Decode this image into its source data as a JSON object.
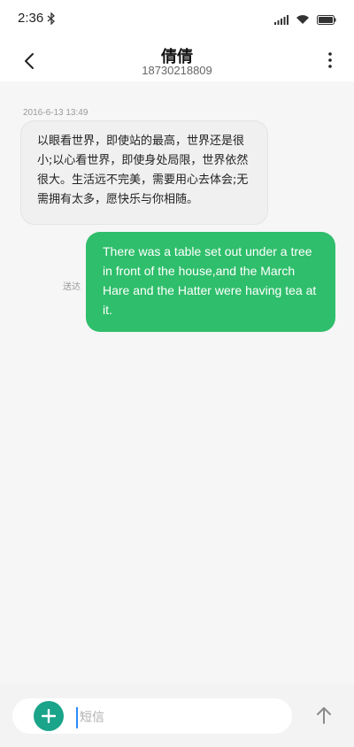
{
  "status_bar": {
    "time": "2:36",
    "icons": [
      "bluetooth-icon",
      "signal-icon",
      "wifi-icon",
      "battery-icon"
    ]
  },
  "header": {
    "title": "倩倩",
    "phone": "18730218809",
    "back_icon": "chevron-left-icon",
    "more_icon": "more-vertical-icon"
  },
  "messages": [
    {
      "direction": "incoming",
      "timestamp": "2016-6-13 13:49",
      "text": "以眼看世界，即使站的最高，世界还是很小;以心看世界，即使身处局限，世界依然很大。生活远不完美，需要用心去体会;无需拥有太多，愿快乐与你相随。"
    },
    {
      "direction": "outgoing",
      "status": "送达",
      "text": "There was a table set out under a tree in front of the house,and the March Hare and the Hatter were having tea at it."
    }
  ],
  "composer": {
    "placeholder": "短信",
    "value": "",
    "add_icon": "plus-icon",
    "send_icon": "arrow-up-icon"
  },
  "colors": {
    "outgoing_bubble": "#2fbe6b",
    "incoming_bubble": "#f0f0f0",
    "add_button": "#1aa48a",
    "background": "#f6f6f6"
  }
}
